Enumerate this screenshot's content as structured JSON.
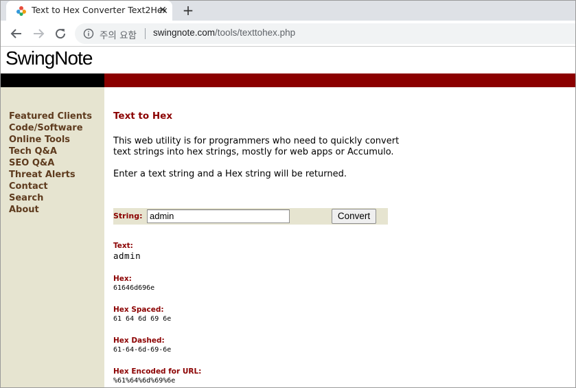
{
  "browser": {
    "tab_title": "Text to Hex Converter Text2Hex",
    "close_glyph": "✕",
    "newtab_glyph": "+",
    "security_label": "주의 요함",
    "url_domain": "swingnote.com",
    "url_path": "/tools/texttohex.php"
  },
  "site": {
    "logo": "SwingNote"
  },
  "sidebar": {
    "items": [
      {
        "label": "Featured Clients"
      },
      {
        "label": "Code/Software"
      },
      {
        "label": "Online Tools"
      },
      {
        "label": "Tech Q&A"
      },
      {
        "label": "SEO Q&A"
      },
      {
        "label": "Threat Alerts"
      },
      {
        "label": "Contact"
      },
      {
        "label": "Search"
      },
      {
        "label": "About"
      }
    ]
  },
  "main": {
    "title": "Text to Hex",
    "desc_line1": "This web utility is for programmers who need to quickly convert",
    "desc_line2": "text strings into hex strings, mostly for web apps or Accumulo.",
    "instruction": "Enter a text string and a Hex string will be returned.",
    "form": {
      "label": "String:",
      "value": "admin",
      "button": "Convert"
    },
    "results": [
      {
        "label": "Text:",
        "value": "admin"
      },
      {
        "label": "Hex:",
        "value": "61646d696e"
      },
      {
        "label": "Hex Spaced:",
        "value": "61 64 6d 69 6e"
      },
      {
        "label": "Hex Dashed:",
        "value": "61-64-6d-69-6e"
      },
      {
        "label": "Hex Encoded for URL:",
        "value": "%61%64%6d%69%6e"
      }
    ]
  },
  "colors": {
    "brand_red": "#8b0000",
    "sidebar_bg": "#e6e4d0",
    "nav_text": "#5e3b1e"
  }
}
